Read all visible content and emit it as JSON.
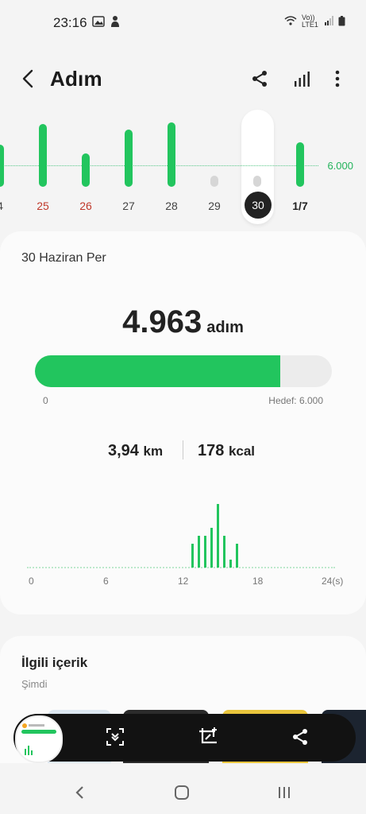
{
  "status_bar": {
    "time": "23:16",
    "network_label": "Vo)) LTE1"
  },
  "header": {
    "title": "Adım"
  },
  "week": {
    "days": [
      {
        "label": "4",
        "value": 4200,
        "color": "green",
        "text_color": "normal"
      },
      {
        "label": "25",
        "value": 6200,
        "color": "green",
        "text_color": "red"
      },
      {
        "label": "26",
        "value": 3300,
        "color": "green",
        "text_color": "red"
      },
      {
        "label": "27",
        "value": 5700,
        "color": "green",
        "text_color": "normal"
      },
      {
        "label": "28",
        "value": 6400,
        "color": "green",
        "text_color": "normal"
      },
      {
        "label": "29",
        "value": 800,
        "color": "grey",
        "text_color": "normal"
      },
      {
        "label": "30",
        "value": 1000,
        "color": "grey",
        "text_color": "selected"
      },
      {
        "label": "1/7",
        "value": 4400,
        "color": "green",
        "text_color": "bold"
      }
    ],
    "goal_label": "6.000"
  },
  "summary": {
    "date": "30 Haziran Per",
    "steps": "4.963",
    "steps_unit": "adım",
    "progress_fraction": 0.827,
    "progress_min": "0",
    "progress_max": "Hedef: 6.000",
    "distance": "3,94",
    "distance_unit": "km",
    "calories": "178",
    "calories_unit": "kcal"
  },
  "hourly_chart": {
    "x_labels": [
      "0",
      "6",
      "12",
      "18",
      "24(s)"
    ],
    "hours": [
      12.6,
      13.1,
      13.6,
      14.1,
      14.6,
      15.1,
      15.6,
      16.1,
      16.6
    ],
    "values": [
      30,
      40,
      40,
      50,
      80,
      40,
      10,
      30,
      0
    ]
  },
  "related": {
    "title": "İlgili içerik",
    "subtitle": "Şimdi"
  },
  "colors": {
    "accent": "#22c55e",
    "selected": "#222222",
    "weekend": "#c0392b"
  },
  "icons": [
    "back-icon",
    "share-icon",
    "bar-chart-icon",
    "more-icon",
    "scroll-capture-icon",
    "crop-edit-icon",
    "share-icon",
    "nav-back-icon",
    "nav-home-icon",
    "nav-recents-icon"
  ]
}
